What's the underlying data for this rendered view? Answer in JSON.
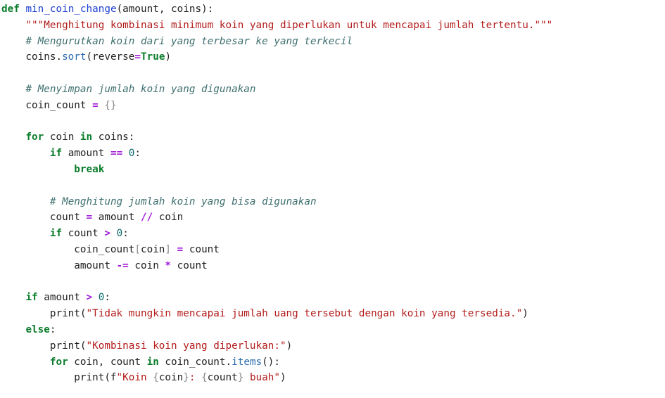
{
  "code": {
    "lines": [
      [
        {
          "t": "def",
          "c": "kw"
        },
        {
          "t": " "
        },
        {
          "t": "min_coin_change",
          "c": "fn"
        },
        {
          "t": "(amount, coins):"
        }
      ],
      [
        {
          "t": "    "
        },
        {
          "t": "\"\"\"Menghitung kombinasi minimum koin yang diperlukan untuk mencapai jumlah tertentu.\"\"\"",
          "c": "str"
        }
      ],
      [
        {
          "t": "    "
        },
        {
          "t": "# Mengurutkan koin dari yang terbesar ke yang terkecil",
          "c": "cm"
        }
      ],
      [
        {
          "t": "    coins."
        },
        {
          "t": "sort",
          "c": "meth"
        },
        {
          "t": "(reverse"
        },
        {
          "t": "=",
          "c": "op"
        },
        {
          "t": "True",
          "c": "kw"
        },
        {
          "t": ")"
        }
      ],
      [
        {
          "t": ""
        }
      ],
      [
        {
          "t": "    "
        },
        {
          "t": "# Menyimpan jumlah koin yang digunakan",
          "c": "cm"
        }
      ],
      [
        {
          "t": "    coin_count "
        },
        {
          "t": "=",
          "c": "op"
        },
        {
          "t": " "
        },
        {
          "t": "{}",
          "c": "br"
        }
      ],
      [
        {
          "t": ""
        }
      ],
      [
        {
          "t": "    "
        },
        {
          "t": "for",
          "c": "kw"
        },
        {
          "t": " coin "
        },
        {
          "t": "in",
          "c": "kw"
        },
        {
          "t": " coins:"
        }
      ],
      [
        {
          "t": "        "
        },
        {
          "t": "if",
          "c": "kw"
        },
        {
          "t": " amount "
        },
        {
          "t": "==",
          "c": "op"
        },
        {
          "t": " "
        },
        {
          "t": "0",
          "c": "num"
        },
        {
          "t": ":"
        }
      ],
      [
        {
          "t": "            "
        },
        {
          "t": "break",
          "c": "kw"
        }
      ],
      [
        {
          "t": ""
        }
      ],
      [
        {
          "t": "        "
        },
        {
          "t": "# Menghitung jumlah koin yang bisa digunakan",
          "c": "cm"
        }
      ],
      [
        {
          "t": "        count "
        },
        {
          "t": "=",
          "c": "op"
        },
        {
          "t": " amount "
        },
        {
          "t": "//",
          "c": "op"
        },
        {
          "t": " coin"
        }
      ],
      [
        {
          "t": "        "
        },
        {
          "t": "if",
          "c": "kw"
        },
        {
          "t": " count "
        },
        {
          "t": ">",
          "c": "op"
        },
        {
          "t": " "
        },
        {
          "t": "0",
          "c": "num"
        },
        {
          "t": ":"
        }
      ],
      [
        {
          "t": "            coin_count"
        },
        {
          "t": "[",
          "c": "br"
        },
        {
          "t": "coin"
        },
        {
          "t": "]",
          "c": "br"
        },
        {
          "t": " "
        },
        {
          "t": "=",
          "c": "op"
        },
        {
          "t": " count"
        }
      ],
      [
        {
          "t": "            amount "
        },
        {
          "t": "-=",
          "c": "op"
        },
        {
          "t": " coin "
        },
        {
          "t": "*",
          "c": "op"
        },
        {
          "t": " count"
        }
      ],
      [
        {
          "t": ""
        }
      ],
      [
        {
          "t": "    "
        },
        {
          "t": "if",
          "c": "kw"
        },
        {
          "t": " amount "
        },
        {
          "t": ">",
          "c": "op"
        },
        {
          "t": " "
        },
        {
          "t": "0",
          "c": "num"
        },
        {
          "t": ":"
        }
      ],
      [
        {
          "t": "        print("
        },
        {
          "t": "\"Tidak mungkin mencapai jumlah uang tersebut dengan koin yang tersedia.\"",
          "c": "str"
        },
        {
          "t": ")"
        }
      ],
      [
        {
          "t": "    "
        },
        {
          "t": "else",
          "c": "kw"
        },
        {
          "t": ":"
        }
      ],
      [
        {
          "t": "        print("
        },
        {
          "t": "\"Kombinasi koin yang diperlukan:\"",
          "c": "str"
        },
        {
          "t": ")"
        }
      ],
      [
        {
          "t": "        "
        },
        {
          "t": "for",
          "c": "kw"
        },
        {
          "t": " coin, count "
        },
        {
          "t": "in",
          "c": "kw"
        },
        {
          "t": " coin_count."
        },
        {
          "t": "items",
          "c": "meth"
        },
        {
          "t": "():"
        }
      ],
      [
        {
          "t": "            print(f"
        },
        {
          "t": "\"Koin ",
          "c": "str"
        },
        {
          "t": "{",
          "c": "br"
        },
        {
          "t": "coin"
        },
        {
          "t": "}",
          "c": "br"
        },
        {
          "t": ": ",
          "c": "str"
        },
        {
          "t": "{",
          "c": "br"
        },
        {
          "t": "count"
        },
        {
          "t": "}",
          "c": "br"
        },
        {
          "t": " buah\"",
          "c": "str"
        },
        {
          "t": ")"
        }
      ]
    ]
  }
}
